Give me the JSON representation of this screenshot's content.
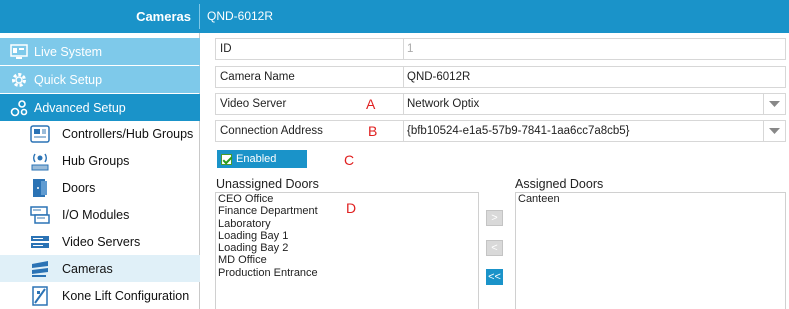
{
  "titlebar": {
    "section": "Cameras",
    "item": "QND-6012R"
  },
  "sidebar": {
    "top": [
      {
        "label": "Live System",
        "icon": "monitor-icon"
      },
      {
        "label": "Quick Setup",
        "icon": "gear-icon"
      },
      {
        "label": "Advanced Setup",
        "icon": "settings-tree-icon"
      }
    ],
    "items": [
      {
        "label": "Controllers/Hub Groups",
        "icon": "controllers-icon"
      },
      {
        "label": "Hub Groups",
        "icon": "hub-groups-icon"
      },
      {
        "label": "Doors",
        "icon": "doors-icon"
      },
      {
        "label": "I/O Modules",
        "icon": "io-modules-icon"
      },
      {
        "label": "Video Servers",
        "icon": "video-servers-icon"
      },
      {
        "label": "Cameras",
        "icon": "cameras-icon"
      },
      {
        "label": "Kone Lift Configuration",
        "icon": "lift-icon"
      }
    ]
  },
  "form": {
    "id": {
      "label": "ID",
      "value": "1"
    },
    "camera_name": {
      "label": "Camera Name",
      "value": "QND-6012R"
    },
    "video_server": {
      "label": "Video Server",
      "value": "Network Optix"
    },
    "connection_address": {
      "label": "Connection Address",
      "value": "{bfb10524-e1a5-57b9-7841-1aa6cc7a8cb5}"
    },
    "enabled": {
      "label": "Enabled",
      "checked": true
    }
  },
  "markers": {
    "a": "A",
    "b": "B",
    "c": "C",
    "d": "D"
  },
  "doors": {
    "unassigned_title": "Unassigned Doors",
    "assigned_title": "Assigned Doors",
    "unassigned": [
      "CEO Office",
      "Finance Department",
      "Laboratory",
      "Loading Bay 1",
      "Loading Bay 2",
      "MD Office",
      "Production Entrance"
    ],
    "assigned": [
      "Canteen"
    ],
    "buttons": {
      "add": ">",
      "remove": "<",
      "remove_all": "<<"
    }
  },
  "colors": {
    "accent": "#1a93c9",
    "accent_light": "#7ec9ea",
    "marker": "#e02020"
  }
}
